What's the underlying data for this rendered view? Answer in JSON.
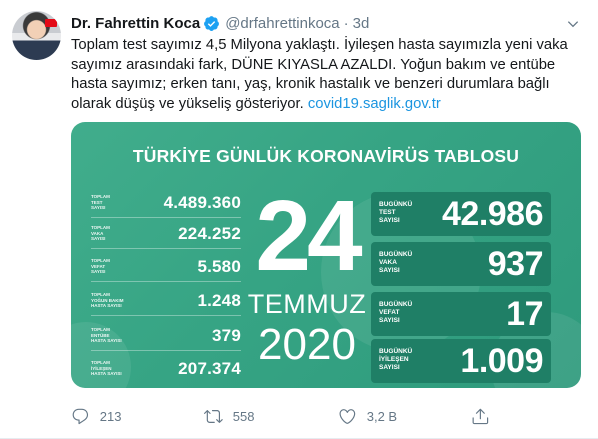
{
  "tweet": {
    "author_name": "Dr. Fahrettin Koca",
    "handle": "@drfahrettinkoca",
    "separator": "·",
    "time": "3d",
    "text_lines": [
      "Toplam test sayımız 4,5 Milyona yaklaştı. İyileşen hasta sayımızla yeni vaka",
      "sayımız arasındaki fark, DÜNE KIYASLA AZALDI. Yoğun bakım ve entübe",
      "hasta sayımız; erken tanı, yaş, kronik hastalık ve benzeri durumlara bağlı",
      "olarak düşüş ve yükseliş gösteriyor. "
    ],
    "link": "covid19.saglik.gov.tr"
  },
  "card": {
    "title": "TÜRKİYE GÜNLÜK KORONAVİRÜS TABLOSU",
    "day": "24",
    "month": "TEMMUZ",
    "year": "2020",
    "left_stats": [
      {
        "label_line1": "TOPLAM",
        "label_line2": "TEST",
        "label_line3": "SAYISI",
        "value": "4.489.360"
      },
      {
        "label_line1": "TOPLAM",
        "label_line2": "VAKA",
        "label_line3": "SAYISI",
        "value": "224.252"
      },
      {
        "label_line1": "TOPLAM",
        "label_line2": "VEFAT",
        "label_line3": "SAYISI",
        "value": "5.580"
      },
      {
        "label_line1": "TOPLAM",
        "label_line2": "YOĞUN BAKIM",
        "label_line3": "HASTA SAYISI",
        "value": "1.248"
      },
      {
        "label_line1": "TOPLAM",
        "label_line2": "ENTÜBE",
        "label_line3": "HASTA SAYISI",
        "value": "379"
      },
      {
        "label_line1": "TOPLAM",
        "label_line2": "İYİLEŞEN",
        "label_line3": "HASTA SAYISI",
        "value": "207.374"
      }
    ],
    "right_stats": [
      {
        "label_line1": "BUGÜNKÜ",
        "label_line2": "TEST",
        "label_line3": "SAYISI",
        "value": "42.986"
      },
      {
        "label_line1": "BUGÜNKÜ",
        "label_line2": "VAKA",
        "label_line3": "SAYISI",
        "value": "937"
      },
      {
        "label_line1": "BUGÜNKÜ",
        "label_line2": "VEFAT",
        "label_line3": "SAYISI",
        "value": "17"
      },
      {
        "label_line1": "BUGÜNKÜ",
        "label_line2": "İYİLEŞEN",
        "label_line3": "SAYISI",
        "value": "1.009"
      }
    ]
  },
  "actions": {
    "reply_count": "213",
    "retweet_count": "558",
    "like_count": "3,2 B"
  },
  "colors": {
    "card_green": "#36a484",
    "panel_dark": "#1f7f66",
    "link_blue": "#1b95e0",
    "verified_blue": "#1da1f2",
    "muted_gray": "#657786"
  },
  "icons": [
    "verified-badge-icon",
    "chevron-down-icon",
    "reply-icon",
    "retweet-icon",
    "like-icon",
    "share-icon"
  ]
}
